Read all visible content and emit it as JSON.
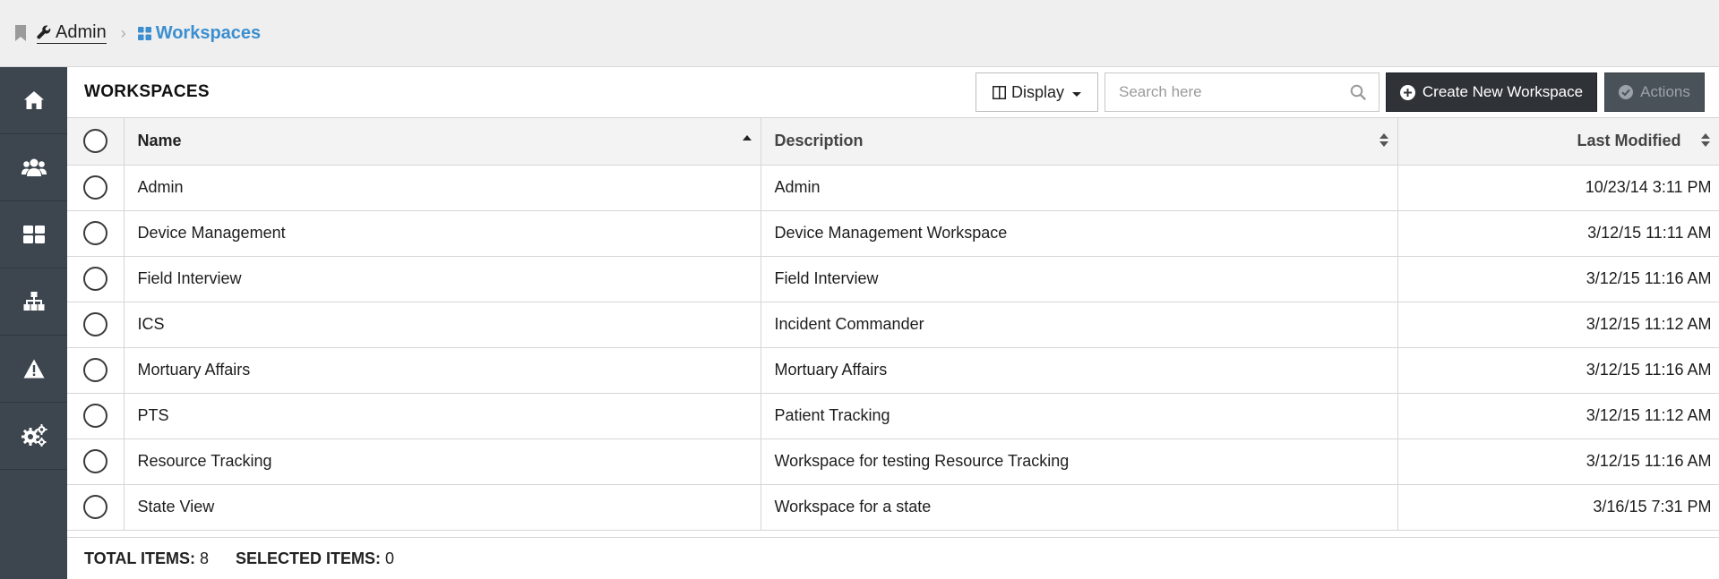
{
  "breadcrumb": {
    "parent_label": "Admin",
    "current_label": "Workspaces"
  },
  "sidebar": {
    "items": [
      {
        "icon": "home-icon"
      },
      {
        "icon": "users-icon"
      },
      {
        "icon": "grid-icon"
      },
      {
        "icon": "sitemap-icon"
      },
      {
        "icon": "warning-icon"
      },
      {
        "icon": "gears-icon"
      }
    ]
  },
  "toolbar": {
    "title": "WORKSPACES",
    "display_label": "Display",
    "search_placeholder": "Search here",
    "create_label": "Create New Workspace",
    "actions_label": "Actions"
  },
  "table": {
    "columns": [
      "Name",
      "Description",
      "Last Modified"
    ],
    "rows": [
      {
        "name": "Admin",
        "description": "Admin",
        "modified": "10/23/14 3:11 PM"
      },
      {
        "name": "Device Management",
        "description": "Device Management Workspace",
        "modified": "3/12/15 11:11 AM"
      },
      {
        "name": "Field Interview",
        "description": "Field Interview",
        "modified": "3/12/15 11:16 AM"
      },
      {
        "name": "ICS",
        "description": "Incident Commander",
        "modified": "3/12/15 11:12 AM"
      },
      {
        "name": "Mortuary Affairs",
        "description": "Mortuary Affairs",
        "modified": "3/12/15 11:16 AM"
      },
      {
        "name": "PTS",
        "description": "Patient Tracking",
        "modified": "3/12/15 11:12 AM"
      },
      {
        "name": "Resource Tracking",
        "description": "Workspace for testing Resource Tracking",
        "modified": "3/12/15 11:16 AM"
      },
      {
        "name": "State View",
        "description": "Workspace for a state",
        "modified": "3/16/15 7:31 PM"
      }
    ]
  },
  "footer": {
    "total_label": "TOTAL ITEMS:",
    "total_value": "8",
    "selected_label": "SELECTED ITEMS:",
    "selected_value": "0"
  },
  "colors": {
    "sidebar_bg": "#3d464f",
    "link_blue": "#3b8fd0",
    "primary_button": "#2f3338"
  }
}
